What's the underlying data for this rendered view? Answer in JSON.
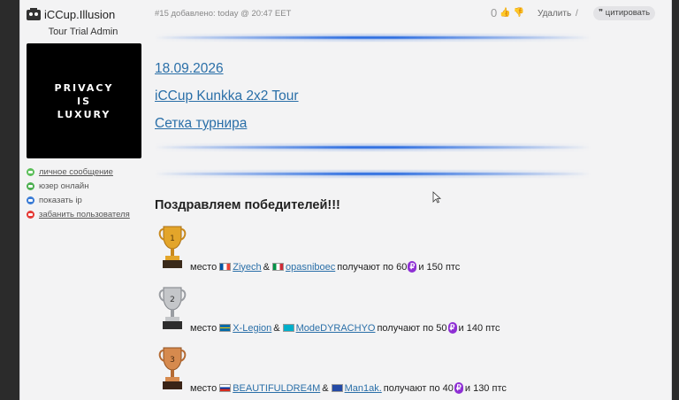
{
  "user": {
    "name": "iCCup.Illusion",
    "title": "Tour Trial Admin",
    "avatar_lines": [
      "PRIVACY",
      "IS",
      "LUXURY"
    ],
    "actions": [
      {
        "label": "личное сообщение",
        "color": "#5cbf5a",
        "icon": "message-icon",
        "link": true
      },
      {
        "label": "юзер онлайн",
        "color": "#4caf50",
        "icon": "online-icon",
        "link": false
      },
      {
        "label": "показать ip",
        "color": "#3a7bd5",
        "icon": "ip-icon",
        "link": false
      },
      {
        "label": "забанить пользователя",
        "color": "#e53935",
        "icon": "ban-icon",
        "link": true
      }
    ]
  },
  "post": {
    "meta": "#15 добавлено: today @ 20:47 EET",
    "rating": "0",
    "delete_label": "Удалить",
    "separator": "/",
    "quote_label": "цитировать"
  },
  "content": {
    "date_link": "18.09.2026",
    "tour_link": "iCCup Kunkka 2x2 Tour",
    "bracket_link": "Сетка турнира",
    "congrats": "Поздравляем победителей!!!",
    "places": [
      {
        "rank": "1",
        "cup": "gold",
        "word": "место",
        "p1": "Ziyech",
        "flag1": "france",
        "amp": "&",
        "p2": "opasniboec",
        "flag2": "italy",
        "prize_text": "получают по 60",
        "coin": "₽",
        "pts": "и 150 птс"
      },
      {
        "rank": "2",
        "cup": "silver",
        "word": "место",
        "p1": "X-Legion",
        "flag1": "sweden",
        "amp": "&",
        "p2": "ModeDYRACHYO",
        "flag2": "kazakhstan",
        "prize_text": "получают по 50",
        "coin": "₽",
        "pts": "и 140 птс"
      },
      {
        "rank": "3",
        "cup": "bronze",
        "word": "место",
        "p1": "BEAUTIFULDRE4M",
        "flag1": "russia",
        "amp": "&",
        "p2": "Man1ak.",
        "flag2": "kosovo",
        "prize_text": "получают по 40",
        "coin": "₽",
        "pts": "и 130 птс"
      }
    ]
  },
  "colors": {
    "link": "#2a6fa8",
    "divider": "#2b6ce0",
    "coin": "#8e2fd4"
  }
}
